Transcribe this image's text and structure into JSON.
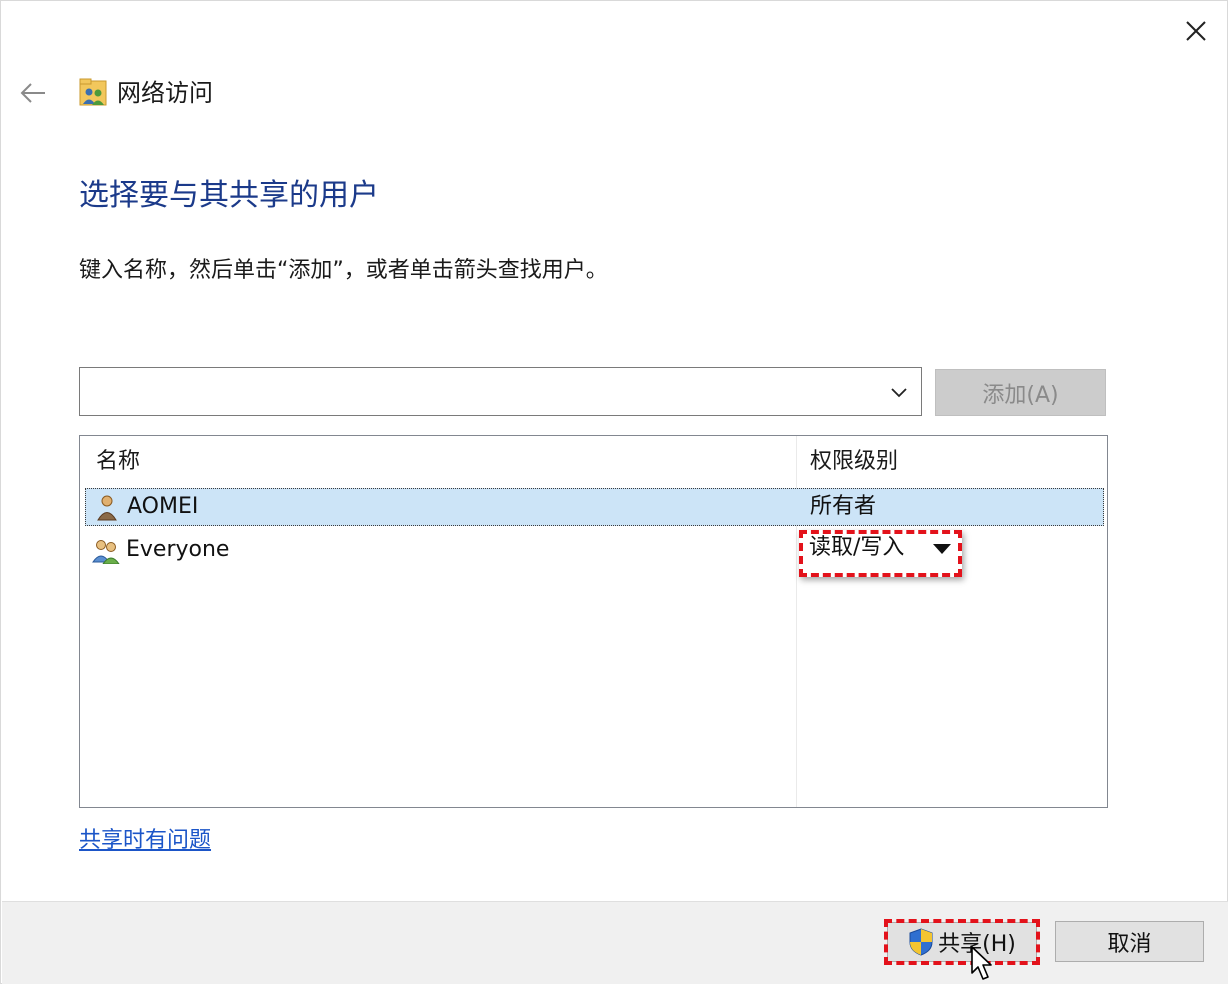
{
  "window": {
    "title": "网络访问",
    "close_icon": "close-icon",
    "back_icon": "back-arrow-icon"
  },
  "main": {
    "heading": "选择要与其共享的用户",
    "instruction": "键入名称，然后单击“添加”，或者单击箭头查找用户。",
    "name_input": {
      "value": "",
      "placeholder": ""
    },
    "add_button_label": "添加(A)",
    "add_button_enabled": false
  },
  "table": {
    "headers": {
      "name": "名称",
      "permission": "权限级别"
    },
    "rows": [
      {
        "name": "AOMEI",
        "permission": "所有者",
        "icon": "user-icon",
        "selected": true
      },
      {
        "name": "Everyone",
        "permission": "读取/写入",
        "icon": "users-group-icon",
        "has_dropdown": true
      }
    ]
  },
  "help_link": "共享时有问题",
  "footer": {
    "share_button_label": "共享(H)",
    "cancel_button_label": "取消"
  },
  "colors": {
    "heading": "#1b3a8a",
    "link": "#1b55c8",
    "selected_row": "#cce4f7",
    "annotation_red": "#e3121b"
  }
}
